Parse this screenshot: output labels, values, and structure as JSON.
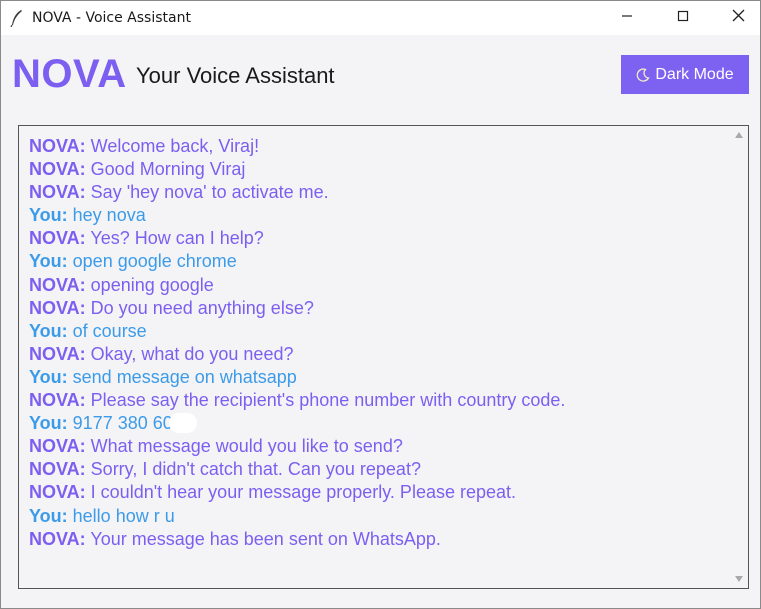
{
  "window": {
    "title": "NOVA - Voice Assistant",
    "icon": "feather-icon"
  },
  "header": {
    "brand": "NOVA",
    "subtitle": "Your Voice Assistant",
    "dark_mode_label": "Dark Mode",
    "dark_mode_icon": "moon-icon"
  },
  "colors": {
    "accent": "#7c5ff0",
    "user": "#3c9be8",
    "background": "#f4f4f7"
  },
  "chat": {
    "messages": [
      {
        "speaker": "NOVA:",
        "text": " Welcome back, Viraj!"
      },
      {
        "speaker": "NOVA:",
        "text": " Good Morning Viraj"
      },
      {
        "speaker": "NOVA:",
        "text": " Say 'hey nova' to activate me."
      },
      {
        "speaker": "You:",
        "text": " hey nova"
      },
      {
        "speaker": "NOVA:",
        "text": " Yes? How can I help?"
      },
      {
        "speaker": "You:",
        "text": " open google chrome"
      },
      {
        "speaker": "NOVA:",
        "text": " opening google"
      },
      {
        "speaker": "NOVA:",
        "text": " Do you need anything else?"
      },
      {
        "speaker": "You:",
        "text": " of course"
      },
      {
        "speaker": "NOVA:",
        "text": " Okay, what do you need?"
      },
      {
        "speaker": "You:",
        "text": " send message on whatsapp"
      },
      {
        "speaker": "NOVA:",
        "text": " Please say the recipient's phone number with country code."
      },
      {
        "speaker": "You:",
        "text": " 9177 380 60"
      },
      {
        "speaker": "NOVA:",
        "text": " What message would you like to send?"
      },
      {
        "speaker": "NOVA:",
        "text": " Sorry, I didn't catch that. Can you repeat?"
      },
      {
        "speaker": "NOVA:",
        "text": " I couldn't hear your message properly. Please repeat."
      },
      {
        "speaker": "You:",
        "text": " hello how r u"
      },
      {
        "speaker": "NOVA:",
        "text": " Your message has been sent on WhatsApp."
      }
    ]
  }
}
